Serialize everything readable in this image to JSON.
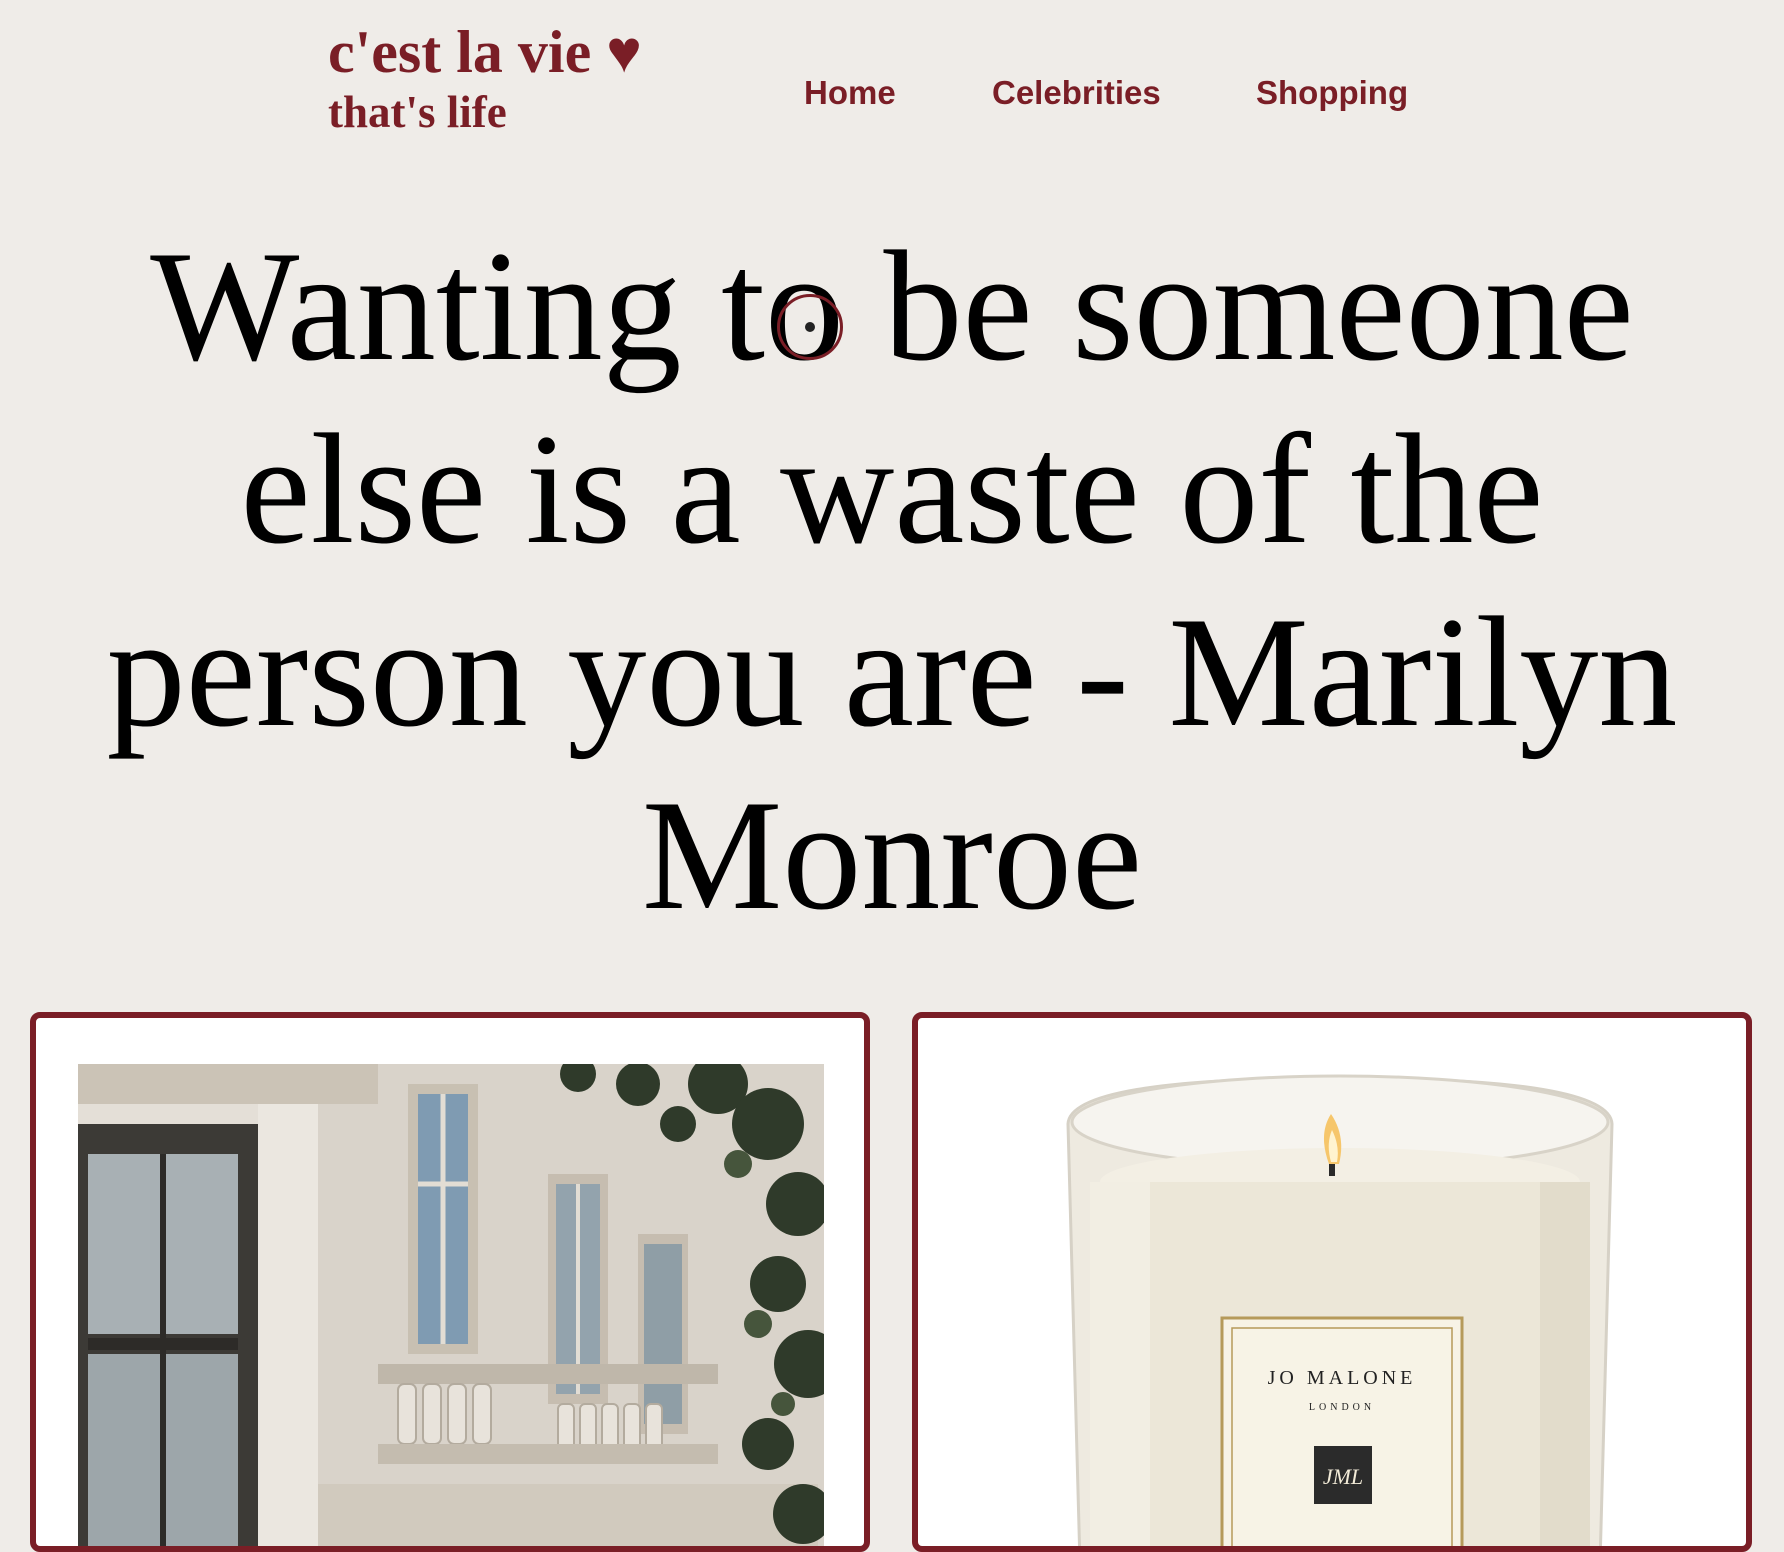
{
  "logo": {
    "line1": "c'est la vie ♥",
    "line2": "that's life"
  },
  "nav": {
    "items": [
      {
        "label": "Home"
      },
      {
        "label": "Celebrities"
      },
      {
        "label": "Shopping"
      }
    ]
  },
  "quote": {
    "text": "Wanting to be someone else is a waste of the person you are - Marilyn Monroe"
  },
  "cards": [
    {
      "image": "building-facade-photo"
    },
    {
      "image": "jo-malone-candle-photo",
      "label_brand": "JO MALONE",
      "label_city": "LONDON",
      "label_monogram": "JML"
    }
  ],
  "colors": {
    "accent": "#7a1e26",
    "background": "#efece8",
    "card": "#ffffff"
  }
}
